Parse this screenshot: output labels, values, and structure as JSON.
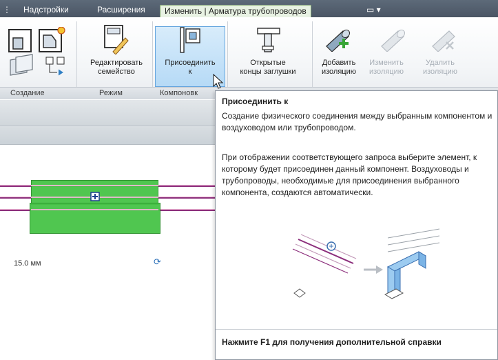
{
  "tabs": {
    "addins": "Надстройки",
    "extensions": "Расширения",
    "modify_context": "Изменить | Арматура трубопроводов",
    "dropdown_glyph": "▭ ▾"
  },
  "ribbon": {
    "tools": {
      "edit_family": "Редактировать\nсемейство",
      "connect_to": "Присоединить\nк",
      "open_caps": "Открытые\nконцы заглушки",
      "add_insulation": "Добавить\nизоляцию",
      "modify_insulation": "Изменить\nизоляцию",
      "remove_insulation": "Удалить\nизоляцию"
    },
    "panels": {
      "create": "Создание",
      "mode": "Режим",
      "layout": "Компоновк"
    }
  },
  "canvas": {
    "dimension_text": "15.0 мм"
  },
  "tooltip": {
    "title": "Присоединить к",
    "description": "Создание физического соединения между выбранным компонентом и воздуховодом или трубопроводом.",
    "details": "При отображении соответствующего запроса выберите элемент, к которому будет присоединен данный компонент. Воздуховоды и трубопроводы, необходимые для присоединения выбранного компонента, создаются автоматически.",
    "footer": "Нажмите F1 для получения дополнительной справки"
  },
  "colors": {
    "tab_bar": "#4f5b69",
    "context_tab": "#e8f2e3",
    "selected_element": "#47c447",
    "highlight_button": "#b6daf6",
    "pipe_pink": "#f0b8d6",
    "pipe_purple": "#8c2f7c"
  },
  "icons": [
    "create-panel-icon",
    "edit-family-icon",
    "connect-to-icon",
    "open-caps-icon",
    "add-insulation-icon",
    "modify-insulation-icon",
    "remove-insulation-icon",
    "rotate-icon",
    "cursor-icon"
  ]
}
